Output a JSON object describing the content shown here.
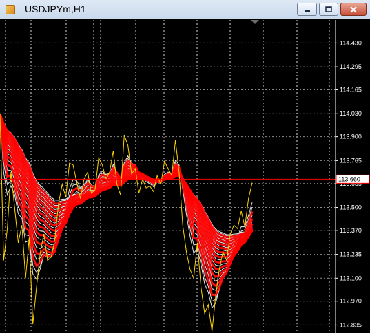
{
  "window": {
    "title": "USDJPYm,H1"
  },
  "controls": {
    "minimize_icon": "minimize-icon",
    "restore_icon": "restore-icon",
    "close_icon": "close-icon"
  },
  "chart_data": {
    "type": "line",
    "symbol": "USDJPYm",
    "timeframe": "H1",
    "price_axis_labels": [
      "114.430",
      "114.295",
      "114.165",
      "114.030",
      "113.900",
      "113.765",
      "113.635",
      "113.500",
      "113.370",
      "113.235",
      "113.100",
      "112.970",
      "112.835"
    ],
    "current_price": "113.660",
    "ylim": [
      112.79,
      114.56
    ],
    "grid": true,
    "colors": {
      "background": "#000000",
      "price_line": "#ffd400",
      "ribbon_fast": "#ff0000",
      "ribbon_slow": "#ffffff",
      "current_price_line": "#ff0000",
      "grid": "#ffffff"
    },
    "series": [
      {
        "values": [
          114.03,
          113.2,
          113.38,
          113.7,
          113.5,
          113.3,
          113.4,
          113.1,
          113.33,
          112.84,
          113.05,
          113.24,
          113.35,
          113.2,
          113.22,
          113.32,
          113.52,
          113.63,
          113.56,
          113.75,
          113.74,
          113.64,
          113.55,
          113.66,
          113.7,
          113.58,
          113.6,
          113.78,
          113.74,
          113.66,
          113.7,
          113.82,
          113.63,
          113.57,
          113.91,
          113.85,
          113.69,
          113.72,
          113.58,
          113.66,
          113.61,
          113.62,
          113.59,
          113.68,
          113.63,
          113.76,
          113.72,
          113.68,
          113.88,
          113.7,
          113.4,
          113.25,
          113.15,
          113.1,
          113.3,
          113.05,
          112.9,
          112.95,
          112.8,
          113.0,
          113.15,
          113.25,
          113.2,
          113.35,
          113.4,
          113.38,
          113.48,
          113.39,
          113.55,
          113.64
        ]
      }
    ]
  }
}
